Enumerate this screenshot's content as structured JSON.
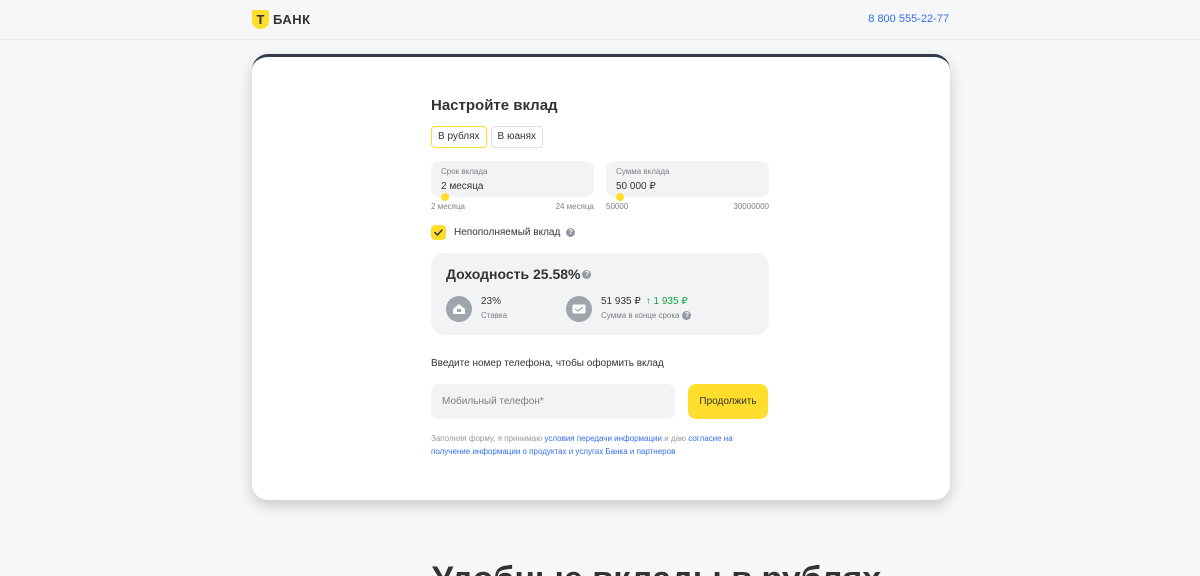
{
  "header": {
    "logo_mark": "Т",
    "logo_text": "БАНК",
    "phone": "8 800 555-22-77"
  },
  "form": {
    "title": "Настройте вклад",
    "tabs": [
      {
        "label": "В рублях",
        "active": true
      },
      {
        "label": "В юанях",
        "active": false
      }
    ],
    "term": {
      "label": "Срок вклада",
      "value": "2 месяца",
      "min": "2 месяца",
      "max": "24 месяца"
    },
    "amount": {
      "label": "Сумма вклада",
      "value": "50 000 ₽",
      "min": "50000",
      "max": "30000000"
    },
    "non_refillable": {
      "label": "Непополняемый вклад",
      "checked": true
    },
    "yield": {
      "title": "Доходность 25.58%",
      "rate_value": "23%",
      "rate_caption": "Ставка",
      "total_value": "51 935 ₽",
      "gain": "1 935 ₽",
      "total_caption": "Сумма в конце срока"
    },
    "phone_prompt": "Введите номер телефона, чтобы оформить вклад",
    "phone_placeholder": "Мобильный телефон*",
    "continue_label": "Продолжить",
    "legal": {
      "prefix": "Заполняя форму, я принимаю",
      "link1": "условия передачи информации",
      "middle": "и даю",
      "link2": "согласие на получение информации о продуктах и услугах Банка и партнеров"
    }
  },
  "section_heading": "Удобные вклады в рублях",
  "colors": {
    "accent": "#ffdd2d",
    "link": "#336fee",
    "gain": "#12a63d"
  }
}
